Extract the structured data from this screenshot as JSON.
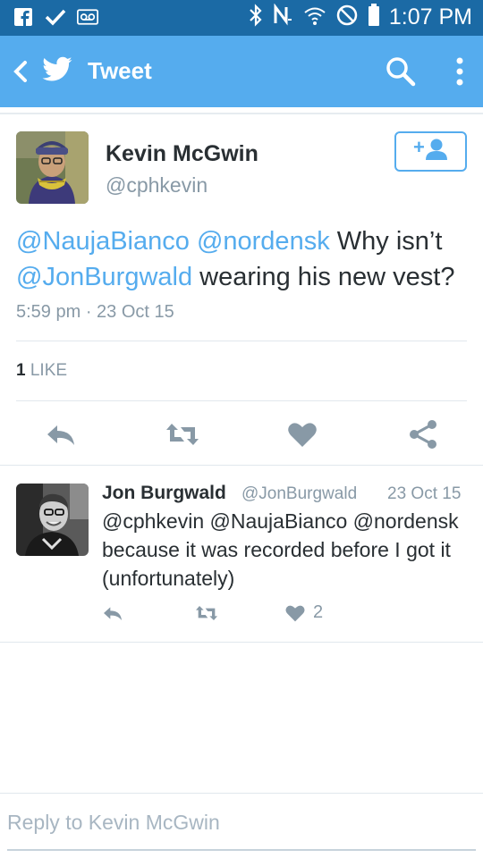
{
  "status_bar": {
    "time": "1:07 PM",
    "icons": [
      "facebook-icon",
      "check-icon",
      "voicemail-icon",
      "bluetooth-icon",
      "nfc-icon",
      "wifi-icon",
      "do-not-disturb-icon",
      "battery-icon"
    ]
  },
  "app_bar": {
    "title": "Tweet",
    "icons": [
      "back-icon",
      "twitter-bird-icon",
      "search-icon",
      "more-icon"
    ]
  },
  "tweet": {
    "author_name": "Kevin McGwin",
    "author_handle": "@cphkevin",
    "follow_icon": "add-user-icon",
    "mention_1": "@NaujaBianco",
    "mention_2": "@nordensk",
    "text_part_1": "Why isn’t",
    "mention_3": "@JonBurgwald",
    "text_part_2": "wearing his new vest?",
    "timestamp": "5:59 pm · 23 Oct 15",
    "like_count": "1",
    "like_label": "LIKE",
    "actions": [
      "reply-icon",
      "retweet-icon",
      "heart-icon",
      "share-icon"
    ]
  },
  "reply": {
    "author_name": "Jon Burgwald",
    "author_handle": "@JonBurgwald",
    "date": "23 Oct 15",
    "text": "@cphkevin @NaujaBianco @nordensk because it was recorded before I got it (unfortunately)",
    "like_count": "2",
    "actions": [
      "reply-icon",
      "retweet-icon",
      "heart-icon"
    ]
  },
  "composer": {
    "placeholder": "Reply to Kevin McGwin"
  },
  "colors": {
    "status_bar": "#1b6aa5",
    "app_bar": "#55acee",
    "link": "#55acee",
    "muted": "#8899a6",
    "text": "#292f33"
  }
}
